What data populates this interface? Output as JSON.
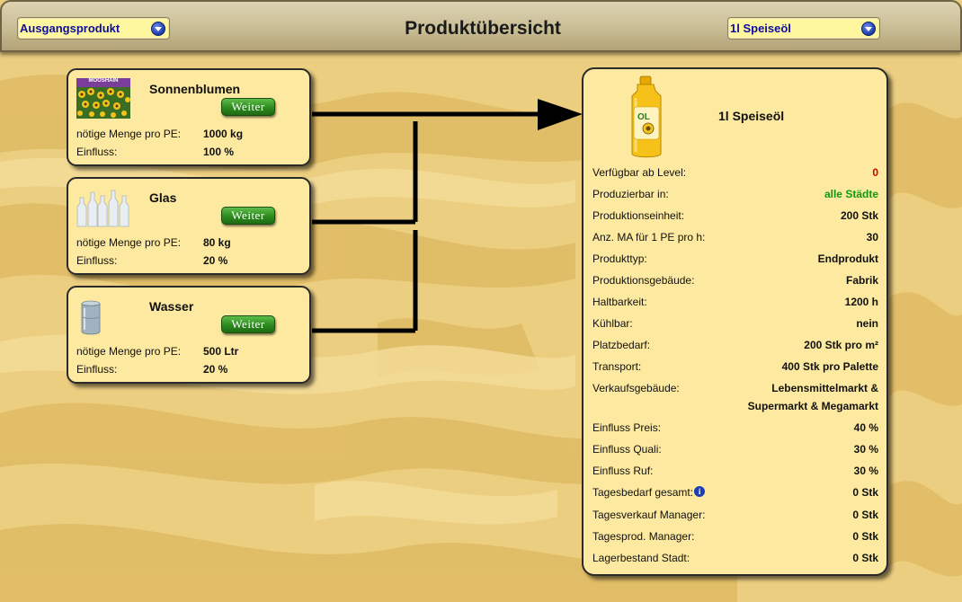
{
  "header": {
    "title": "Produktübersicht",
    "left_select": {
      "value": "Ausgangsprodukt"
    },
    "right_select": {
      "value": "1l Speiseöl"
    }
  },
  "ingredients": [
    {
      "name": "Sonnenblumen",
      "button": "Weiter",
      "amount_label": "nötige Menge pro PE:",
      "amount": "1000 kg",
      "influence_label": "Einfluss:",
      "influence": "100 %",
      "image_text": "MOOSHAIN"
    },
    {
      "name": "Glas",
      "button": "Weiter",
      "amount_label": "nötige Menge pro PE:",
      "amount": "80 kg",
      "influence_label": "Einfluss:",
      "influence": "20 %"
    },
    {
      "name": "Wasser",
      "button": "Weiter",
      "amount_label": "nötige Menge pro PE:",
      "amount": "500 Ltr",
      "influence_label": "Einfluss:",
      "influence": "20 %"
    }
  ],
  "product": {
    "name": "1l Speiseöl",
    "bottle_label": "OL",
    "properties": [
      {
        "label": "Verfügbar ab Level:",
        "value": "0",
        "color": "#cc0000"
      },
      {
        "label": "Produzierbar in:",
        "value": "alle Städte",
        "color": "#119911"
      },
      {
        "label": "Produktionseinheit:",
        "value": "200 Stk"
      },
      {
        "label": "Anz. MA für 1 PE pro h:",
        "value": "30"
      },
      {
        "label": "Produkttyp:",
        "value": "Endprodukt"
      },
      {
        "label": "Produktionsgebäude:",
        "value": "Fabrik"
      },
      {
        "label": "Haltbarkeit:",
        "value": "1200 h"
      },
      {
        "label": "Kühlbar:",
        "value": "nein"
      },
      {
        "label": "Platzbedarf:",
        "value": "200 Stk pro m²"
      },
      {
        "label": "Transport:",
        "value": "400 Stk pro Palette"
      },
      {
        "label": "Verkaufsgebäude:",
        "value": "Lebensmittelmarkt &",
        "value2": "Supermarkt & Megamarkt"
      },
      {
        "label": "Einfluss Preis:",
        "value": "40 %"
      },
      {
        "label": "Einfluss Quali:",
        "value": "30 %"
      },
      {
        "label": "Einfluss Ruf:",
        "value": "30 %"
      },
      {
        "label": "Tagesbedarf gesamt:",
        "value": "0 Stk",
        "info_icon": "i"
      },
      {
        "label": "Tagesverkauf Manager:",
        "value": "0 Stk"
      },
      {
        "label": "Tagesprod. Manager:",
        "value": "0 Stk"
      },
      {
        "label": "Lagerbestand Stadt:",
        "value": "0 Stk"
      }
    ]
  }
}
